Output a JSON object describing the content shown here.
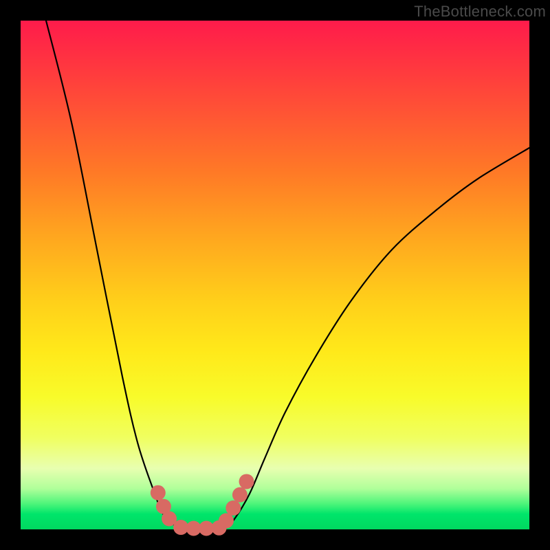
{
  "attribution": "TheBottleneck.com",
  "chart_data": {
    "type": "line",
    "title": "",
    "xlabel": "",
    "ylabel": "",
    "xlim": [
      0,
      1
    ],
    "ylim": [
      0,
      1
    ],
    "series": [
      {
        "name": "curve-left",
        "x": [
          0.05,
          0.1,
          0.15,
          0.2,
          0.23,
          0.26,
          0.28,
          0.3,
          0.32
        ],
        "y": [
          1.0,
          0.8,
          0.55,
          0.3,
          0.17,
          0.08,
          0.03,
          0.01,
          0.0
        ]
      },
      {
        "name": "curve-right",
        "x": [
          0.4,
          0.42,
          0.45,
          0.48,
          0.52,
          0.58,
          0.65,
          0.73,
          0.82,
          0.9,
          1.0
        ],
        "y": [
          0.0,
          0.02,
          0.07,
          0.14,
          0.23,
          0.34,
          0.45,
          0.55,
          0.63,
          0.69,
          0.75
        ]
      }
    ],
    "floor_band": {
      "y_from": 0.0,
      "y_to": 0.015
    },
    "markers": {
      "name": "highlight-dots",
      "color": "#d86a63",
      "points": [
        {
          "x": 0.27,
          "y": 0.072
        },
        {
          "x": 0.281,
          "y": 0.045
        },
        {
          "x": 0.292,
          "y": 0.021
        },
        {
          "x": 0.315,
          "y": 0.004
        },
        {
          "x": 0.34,
          "y": 0.002
        },
        {
          "x": 0.365,
          "y": 0.002
        },
        {
          "x": 0.39,
          "y": 0.003
        },
        {
          "x": 0.404,
          "y": 0.017
        },
        {
          "x": 0.418,
          "y": 0.042
        },
        {
          "x": 0.431,
          "y": 0.068
        },
        {
          "x": 0.444,
          "y": 0.094
        }
      ]
    }
  }
}
